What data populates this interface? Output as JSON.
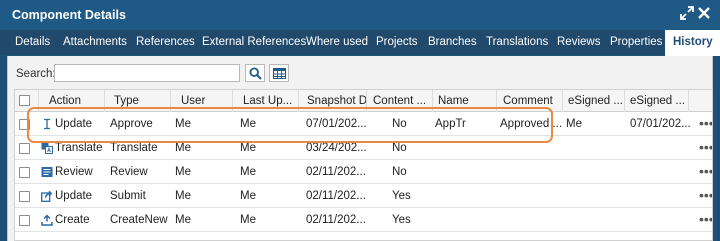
{
  "window": {
    "title": "Component Details",
    "expand_icon": "expand-icon",
    "close_icon": "close-icon"
  },
  "tabs": [
    {
      "label": "Details",
      "active": false
    },
    {
      "label": "Attachments",
      "active": false
    },
    {
      "label": "References",
      "active": false
    },
    {
      "label": "External References",
      "active": false
    },
    {
      "label": "Where used",
      "active": false
    },
    {
      "label": "Projects",
      "active": false
    },
    {
      "label": "Branches",
      "active": false
    },
    {
      "label": "Translations",
      "active": false
    },
    {
      "label": "Reviews",
      "active": false
    },
    {
      "label": "Properties",
      "active": false
    },
    {
      "label": "History",
      "active": true
    }
  ],
  "search": {
    "label": "Search:",
    "value": "",
    "placeholder": ""
  },
  "grid": {
    "columns": [
      "Action",
      "Type",
      "User",
      "Last Up...",
      "Snapshot Da",
      "Content ...",
      "Name",
      "Comment",
      "eSigned ...",
      "eSigned ..."
    ],
    "rows": [
      {
        "icon": "text-cursor-icon",
        "action": "Update",
        "type": "Approve",
        "user": "Me",
        "last_updated": "Me",
        "snapshot_date": "07/01/202...",
        "content": "No",
        "name": "AppTr",
        "comment": "Approved ...",
        "esigned_by": "Me",
        "esigned_date": "07/01/202...",
        "more": "•••"
      },
      {
        "icon": "translate-icon",
        "action": "Translate",
        "type": "Translate",
        "user": "Me",
        "last_updated": "Me",
        "snapshot_date": "03/24/202...",
        "content": "No",
        "name": "",
        "comment": "",
        "esigned_by": "",
        "esigned_date": "",
        "more": "•••"
      },
      {
        "icon": "review-icon",
        "action": "Review",
        "type": "Review",
        "user": "Me",
        "last_updated": "Me",
        "snapshot_date": "02/11/202...",
        "content": "No",
        "name": "",
        "comment": "",
        "esigned_by": "",
        "esigned_date": "",
        "more": "•••"
      },
      {
        "icon": "share-icon",
        "action": "Update",
        "type": "Submit",
        "user": "Me",
        "last_updated": "Me",
        "snapshot_date": "02/11/202...",
        "content": "Yes",
        "name": "",
        "comment": "",
        "esigned_by": "",
        "esigned_date": "",
        "more": "•••"
      },
      {
        "icon": "upload-icon",
        "action": "Create",
        "type": "CreateNew",
        "user": "Me",
        "last_updated": "Me",
        "snapshot_date": "02/11/202...",
        "content": "Yes",
        "name": "",
        "comment": "",
        "esigned_by": "",
        "esigned_date": "",
        "more": "•••"
      }
    ]
  },
  "colors": {
    "titlebar": "#1f5a86",
    "tabbar": "#20496c",
    "highlight": "#e98a43",
    "icon_blue": "#2b6aa6"
  }
}
